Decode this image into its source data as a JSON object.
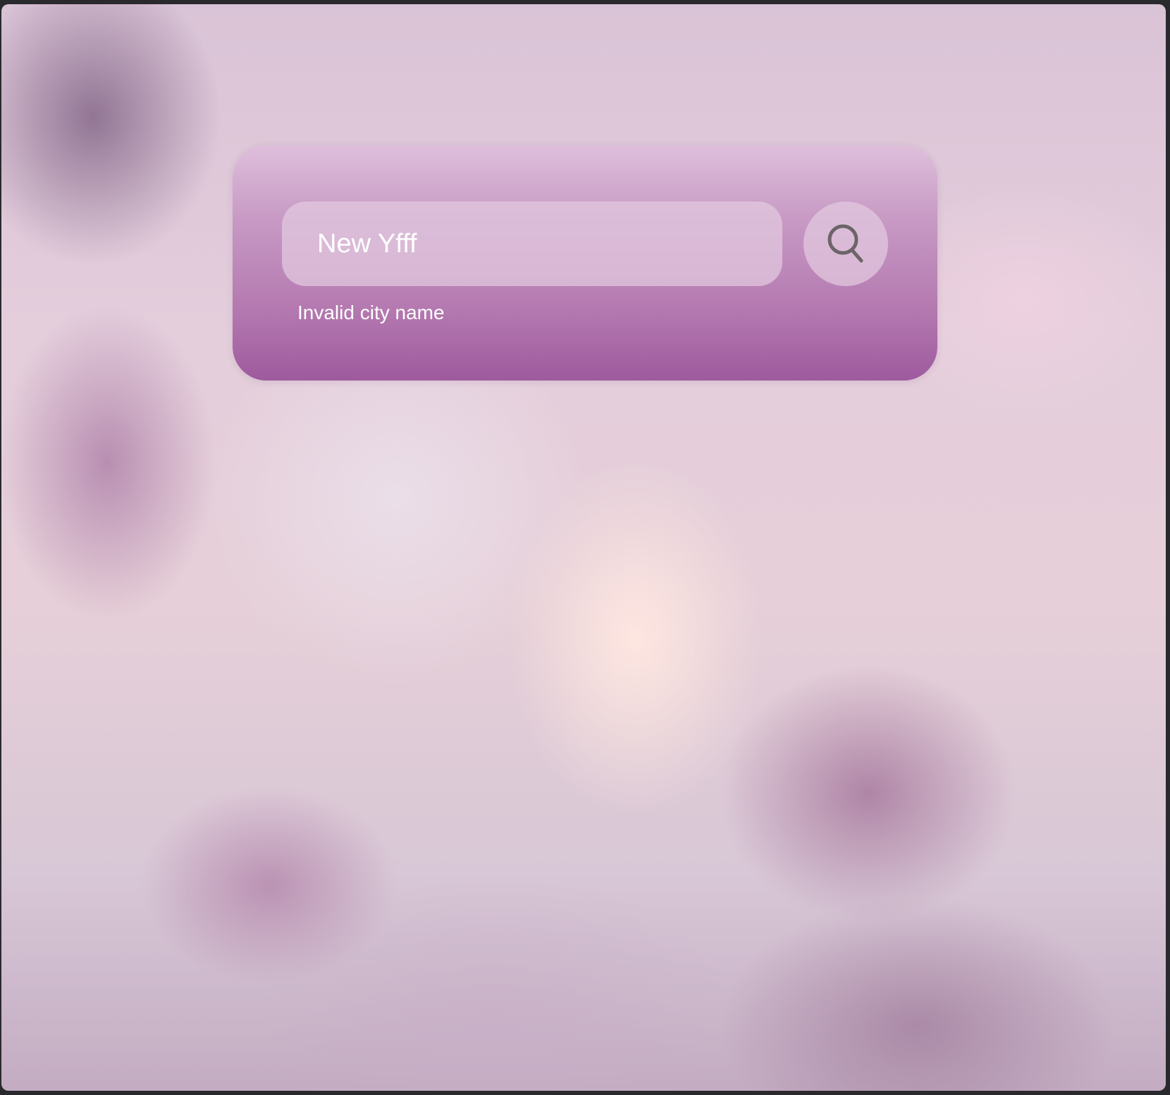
{
  "search": {
    "value": "New Yfff",
    "button_icon": "search-icon"
  },
  "error": {
    "message": "Invalid city name"
  },
  "colors": {
    "card_top": "#dfbfdc",
    "card_bottom": "#9e5a9e",
    "icon": "#6b6468",
    "text": "#ffffff"
  }
}
